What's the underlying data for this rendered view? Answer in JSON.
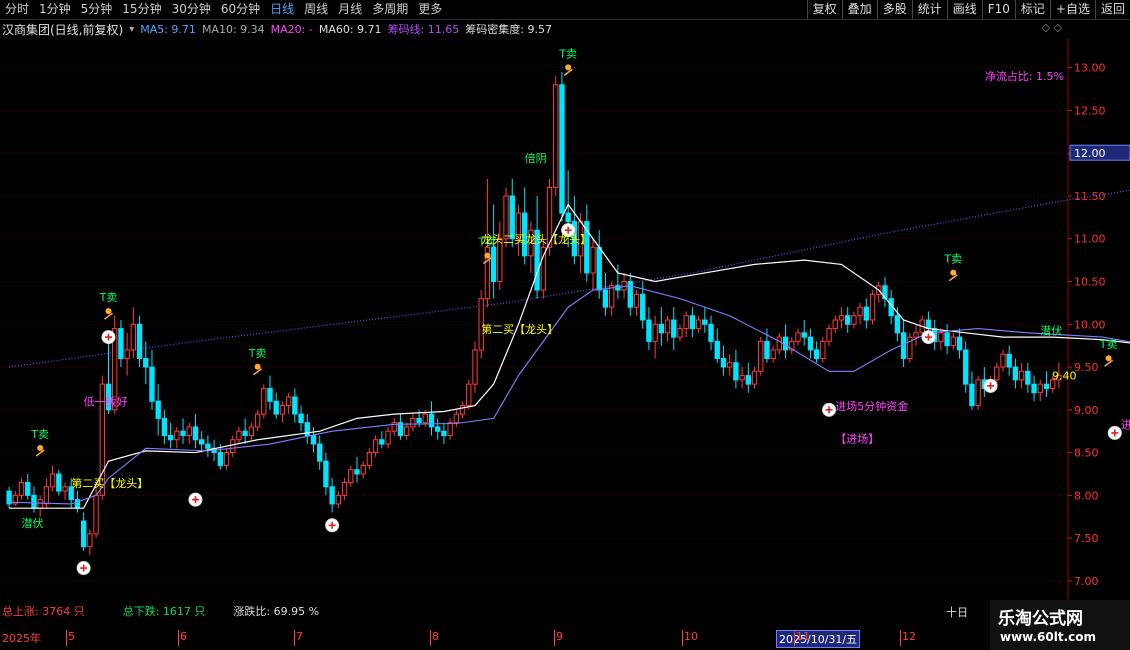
{
  "toolbar": {
    "periods": [
      "分时",
      "1分钟",
      "5分钟",
      "15分钟",
      "30分钟",
      "60分钟",
      "日线",
      "周线",
      "月线",
      "多周期",
      "更多"
    ],
    "active_period": 6,
    "tools": [
      "复权",
      "叠加",
      "多股",
      "统计",
      "画线",
      "F10",
      "标记",
      "+自选",
      "返回"
    ]
  },
  "info": {
    "stock_name": "汉商集团(日线,前复权)",
    "ma5": "MA5: 9.71",
    "ma10": "MA10: 9.34",
    "ma20": "MA20: -",
    "ma60": "MA60: 9.71",
    "chip_line": "筹码线: 11.65",
    "chip_density": "筹码密集度: 9.57",
    "icons": "◇ ◇"
  },
  "colors": {
    "up": "#ff3b3b",
    "down": "#00e5ff",
    "ma_line": "#ffffff",
    "ma2": "#8080ff",
    "buy": "#ffff00",
    "t_sell": "#00ff66",
    "magenta": "#ff40ff",
    "grid": "#8b0000"
  },
  "labels": {
    "net_flow": "净流占比: 1.5%",
    "total_up": "总上涨: 3764 只",
    "total_down": "总下跌: 1617 只",
    "updown_ratio": "涨跌比: 69.95 %",
    "right_bottom": "十日"
  },
  "dates": {
    "year": "2025年",
    "months": [
      "5",
      "6",
      "7",
      "8",
      "9",
      "10",
      "11",
      "12"
    ],
    "current": "2025/10/31/五"
  },
  "watermark": {
    "title": "乐淘公式网",
    "url": "www.60lt.com"
  },
  "chart_data": {
    "type": "candlestick",
    "ylim": [
      6.8,
      13.3
    ],
    "yticks": [
      7.0,
      7.5,
      8.0,
      8.5,
      9.0,
      9.5,
      10.0,
      10.5,
      11.0,
      11.5,
      12.0,
      12.5,
      13.0
    ],
    "yticks_labels": [
      "7.00",
      "7.50",
      "8.00",
      "8.50",
      "9.00",
      "9.50",
      "10.00",
      "10.50",
      "11.00",
      "11.50",
      "12.00",
      "12.50",
      "13.00"
    ],
    "highlight_price": "12.00",
    "last_price": "9.40",
    "ohlc": [
      [
        8.05,
        8.1,
        7.9,
        7.85
      ],
      [
        7.9,
        8.05,
        8.0,
        7.88
      ],
      [
        8.0,
        8.2,
        8.15,
        7.95
      ],
      [
        8.15,
        8.25,
        8.0,
        7.95
      ],
      [
        8.0,
        8.1,
        7.85,
        7.8
      ],
      [
        7.85,
        8.0,
        7.95,
        7.75
      ],
      [
        7.9,
        8.2,
        8.1,
        7.85
      ],
      [
        8.1,
        8.35,
        8.25,
        8.05
      ],
      [
        8.25,
        8.3,
        8.05,
        8.0
      ],
      [
        8.05,
        8.15,
        8.1,
        7.95
      ],
      [
        8.1,
        8.2,
        7.95,
        7.85
      ],
      [
        7.95,
        8.05,
        7.85,
        7.8
      ],
      [
        7.7,
        7.8,
        7.4,
        7.35
      ],
      [
        7.4,
        7.6,
        7.55,
        7.3
      ],
      [
        7.55,
        8.1,
        8.0,
        7.5
      ],
      [
        8.0,
        9.4,
        9.3,
        7.95
      ],
      [
        9.3,
        9.8,
        9.0,
        8.95
      ],
      [
        9.0,
        10.1,
        9.95,
        8.95
      ],
      [
        9.95,
        10.05,
        9.6,
        9.5
      ],
      [
        9.6,
        9.9,
        9.7,
        9.4
      ],
      [
        9.7,
        10.2,
        10.0,
        9.6
      ],
      [
        10.0,
        10.1,
        9.6,
        9.5
      ],
      [
        9.6,
        9.8,
        9.5,
        9.3
      ],
      [
        9.5,
        9.7,
        9.1,
        9.0
      ],
      [
        9.1,
        9.3,
        8.9,
        8.7
      ],
      [
        8.9,
        9.0,
        8.7,
        8.6
      ],
      [
        8.7,
        8.85,
        8.65,
        8.55
      ],
      [
        8.65,
        8.8,
        8.75,
        8.55
      ],
      [
        8.75,
        8.9,
        8.7,
        8.6
      ],
      [
        8.7,
        8.85,
        8.8,
        8.6
      ],
      [
        8.8,
        8.95,
        8.65,
        8.55
      ],
      [
        8.65,
        8.75,
        8.6,
        8.5
      ],
      [
        8.6,
        8.7,
        8.55,
        8.45
      ],
      [
        8.55,
        8.65,
        8.5,
        8.4
      ],
      [
        8.5,
        8.6,
        8.35,
        8.3
      ],
      [
        8.35,
        8.55,
        8.5,
        8.3
      ],
      [
        8.5,
        8.7,
        8.65,
        8.45
      ],
      [
        8.65,
        8.8,
        8.75,
        8.6
      ],
      [
        8.75,
        8.9,
        8.7,
        8.6
      ],
      [
        8.7,
        8.85,
        8.8,
        8.65
      ],
      [
        8.8,
        9.0,
        8.95,
        8.75
      ],
      [
        8.95,
        9.3,
        9.25,
        8.9
      ],
      [
        9.25,
        9.4,
        9.1,
        9.0
      ],
      [
        9.1,
        9.2,
        8.95,
        8.9
      ],
      [
        8.95,
        9.1,
        9.05,
        8.85
      ],
      [
        9.05,
        9.2,
        9.15,
        8.95
      ],
      [
        9.15,
        9.25,
        8.95,
        8.85
      ],
      [
        8.95,
        9.05,
        8.85,
        8.75
      ],
      [
        8.85,
        8.95,
        8.7,
        8.6
      ],
      [
        8.7,
        8.8,
        8.6,
        8.5
      ],
      [
        8.6,
        8.7,
        8.4,
        8.3
      ],
      [
        8.4,
        8.5,
        8.1,
        8.0
      ],
      [
        8.1,
        8.2,
        7.9,
        7.8
      ],
      [
        7.9,
        8.05,
        8.0,
        7.85
      ],
      [
        8.0,
        8.2,
        8.15,
        7.95
      ],
      [
        8.15,
        8.35,
        8.3,
        8.1
      ],
      [
        8.3,
        8.45,
        8.25,
        8.15
      ],
      [
        8.25,
        8.4,
        8.35,
        8.2
      ],
      [
        8.35,
        8.55,
        8.5,
        8.3
      ],
      [
        8.5,
        8.7,
        8.65,
        8.45
      ],
      [
        8.65,
        8.75,
        8.6,
        8.55
      ],
      [
        8.6,
        8.8,
        8.75,
        8.55
      ],
      [
        8.75,
        8.9,
        8.85,
        8.7
      ],
      [
        8.85,
        8.95,
        8.7,
        8.65
      ],
      [
        8.7,
        8.85,
        8.8,
        8.65
      ],
      [
        8.8,
        8.95,
        8.9,
        8.75
      ],
      [
        8.9,
        9.0,
        8.85,
        8.8
      ],
      [
        8.85,
        9.0,
        8.95,
        8.8
      ],
      [
        8.95,
        9.1,
        8.8,
        8.7
      ],
      [
        8.8,
        8.9,
        8.75,
        8.65
      ],
      [
        8.75,
        8.85,
        8.7,
        8.6
      ],
      [
        8.7,
        8.9,
        8.85,
        8.65
      ],
      [
        8.85,
        9.0,
        8.95,
        8.8
      ],
      [
        8.95,
        9.1,
        9.05,
        8.9
      ],
      [
        9.05,
        9.35,
        9.3,
        9.0
      ],
      [
        9.3,
        9.8,
        9.7,
        9.2
      ],
      [
        9.7,
        10.4,
        10.3,
        9.6
      ],
      [
        10.3,
        11.7,
        10.9,
        10.2
      ],
      [
        10.9,
        11.4,
        10.5,
        10.3
      ],
      [
        10.5,
        11.2,
        11.0,
        10.4
      ],
      [
        11.0,
        11.6,
        11.5,
        10.9
      ],
      [
        11.5,
        11.7,
        11.0,
        10.9
      ],
      [
        11.0,
        11.4,
        11.3,
        10.8
      ],
      [
        11.3,
        11.6,
        10.8,
        10.7
      ],
      [
        10.8,
        11.2,
        11.1,
        10.6
      ],
      [
        11.1,
        11.5,
        10.4,
        10.3
      ],
      [
        10.4,
        11.0,
        10.9,
        10.3
      ],
      [
        10.9,
        11.7,
        11.6,
        10.8
      ],
      [
        11.6,
        12.9,
        12.8,
        11.5
      ],
      [
        12.8,
        12.95,
        11.3,
        11.2
      ],
      [
        11.3,
        11.8,
        11.2,
        10.9
      ],
      [
        11.2,
        11.5,
        10.8,
        10.7
      ],
      [
        10.8,
        11.3,
        11.2,
        10.6
      ],
      [
        11.2,
        11.4,
        10.6,
        10.5
      ],
      [
        10.6,
        11.0,
        10.9,
        10.4
      ],
      [
        10.9,
        11.1,
        10.4,
        10.3
      ],
      [
        10.4,
        10.6,
        10.2,
        10.1
      ],
      [
        10.2,
        10.5,
        10.45,
        10.1
      ],
      [
        10.45,
        10.7,
        10.4,
        10.3
      ],
      [
        10.4,
        10.6,
        10.5,
        10.3
      ],
      [
        10.5,
        10.6,
        10.2,
        10.1
      ],
      [
        10.2,
        10.4,
        10.35,
        10.1
      ],
      [
        10.35,
        10.5,
        10.05,
        9.95
      ],
      [
        10.05,
        10.2,
        9.8,
        9.7
      ],
      [
        9.8,
        10.1,
        10.0,
        9.6
      ],
      [
        10.0,
        10.2,
        9.9,
        9.75
      ],
      [
        9.9,
        10.1,
        10.05,
        9.8
      ],
      [
        10.05,
        10.2,
        9.85,
        9.7
      ],
      [
        9.85,
        10.0,
        9.95,
        9.8
      ],
      [
        9.95,
        10.15,
        10.1,
        9.85
      ],
      [
        10.1,
        10.2,
        9.95,
        9.85
      ],
      [
        9.95,
        10.1,
        10.05,
        9.9
      ],
      [
        10.05,
        10.2,
        10.0,
        9.9
      ],
      [
        10.0,
        10.1,
        9.8,
        9.7
      ],
      [
        9.8,
        9.95,
        9.6,
        9.55
      ],
      [
        9.6,
        9.75,
        9.5,
        9.4
      ],
      [
        9.5,
        9.65,
        9.55,
        9.4
      ],
      [
        9.55,
        9.7,
        9.35,
        9.25
      ],
      [
        9.35,
        9.5,
        9.4,
        9.25
      ],
      [
        9.4,
        9.55,
        9.3,
        9.2
      ],
      [
        9.3,
        9.5,
        9.45,
        9.25
      ],
      [
        9.45,
        9.85,
        9.8,
        9.4
      ],
      [
        9.8,
        9.95,
        9.6,
        9.55
      ],
      [
        9.6,
        9.75,
        9.7,
        9.55
      ],
      [
        9.7,
        9.9,
        9.85,
        9.65
      ],
      [
        9.85,
        10.0,
        9.7,
        9.6
      ],
      [
        9.7,
        9.85,
        9.8,
        9.65
      ],
      [
        9.8,
        9.95,
        9.9,
        9.75
      ],
      [
        9.9,
        10.05,
        9.85,
        9.75
      ],
      [
        9.85,
        9.95,
        9.7,
        9.6
      ],
      [
        9.7,
        9.8,
        9.6,
        9.55
      ],
      [
        9.6,
        9.85,
        9.8,
        9.55
      ],
      [
        9.8,
        10.0,
        9.95,
        9.75
      ],
      [
        9.95,
        10.1,
        10.05,
        9.9
      ],
      [
        10.05,
        10.2,
        10.1,
        9.95
      ],
      [
        10.1,
        10.2,
        10.0,
        9.9
      ],
      [
        10.0,
        10.15,
        10.1,
        9.95
      ],
      [
        10.1,
        10.25,
        10.2,
        10.0
      ],
      [
        10.2,
        10.3,
        10.05,
        9.95
      ],
      [
        10.05,
        10.4,
        10.35,
        10.0
      ],
      [
        10.35,
        10.5,
        10.45,
        10.25
      ],
      [
        10.45,
        10.55,
        10.3,
        10.2
      ],
      [
        10.3,
        10.4,
        10.1,
        10.0
      ],
      [
        10.1,
        10.2,
        9.9,
        9.8
      ],
      [
        9.9,
        10.05,
        9.6,
        9.5
      ],
      [
        9.6,
        9.9,
        9.85,
        9.55
      ],
      [
        9.85,
        10.0,
        9.9,
        9.75
      ],
      [
        9.9,
        10.1,
        10.05,
        9.85
      ],
      [
        10.05,
        10.15,
        9.95,
        9.85
      ],
      [
        9.95,
        10.05,
        9.8,
        9.7
      ],
      [
        9.8,
        9.95,
        9.9,
        9.7
      ],
      [
        9.9,
        10.0,
        9.75,
        9.65
      ],
      [
        9.75,
        9.9,
        9.85,
        9.7
      ],
      [
        9.85,
        9.95,
        9.7,
        9.6
      ],
      [
        9.7,
        9.8,
        9.3,
        9.2
      ],
      [
        9.3,
        9.45,
        9.05,
        9.0
      ],
      [
        9.05,
        9.4,
        9.35,
        9.0
      ],
      [
        9.35,
        9.5,
        9.25,
        9.15
      ],
      [
        9.25,
        9.4,
        9.35,
        9.2
      ],
      [
        9.35,
        9.55,
        9.5,
        9.3
      ],
      [
        9.5,
        9.7,
        9.65,
        9.45
      ],
      [
        9.65,
        9.75,
        9.5,
        9.4
      ],
      [
        9.5,
        9.6,
        9.35,
        9.25
      ],
      [
        9.35,
        9.55,
        9.45,
        9.25
      ],
      [
        9.45,
        9.55,
        9.3,
        9.2
      ],
      [
        9.3,
        9.4,
        9.2,
        9.1
      ],
      [
        9.2,
        9.35,
        9.3,
        9.1
      ],
      [
        9.3,
        9.45,
        9.25,
        9.15
      ],
      [
        9.25,
        9.4,
        9.35,
        9.2
      ],
      [
        9.35,
        9.55,
        9.4,
        9.25
      ]
    ],
    "ma_white": [
      [
        0,
        7.85
      ],
      [
        8,
        7.85
      ],
      [
        12,
        7.85
      ],
      [
        16,
        8.4
      ],
      [
        22,
        8.52
      ],
      [
        30,
        8.5
      ],
      [
        40,
        8.65
      ],
      [
        50,
        8.75
      ],
      [
        56,
        8.9
      ],
      [
        62,
        8.95
      ],
      [
        70,
        8.98
      ],
      [
        75,
        9.05
      ],
      [
        78,
        9.3
      ],
      [
        82,
        10.0
      ],
      [
        86,
        10.8
      ],
      [
        90,
        11.4
      ],
      [
        94,
        11.0
      ],
      [
        98,
        10.6
      ],
      [
        104,
        10.5
      ],
      [
        112,
        10.6
      ],
      [
        120,
        10.7
      ],
      [
        128,
        10.75
      ],
      [
        134,
        10.7
      ],
      [
        140,
        10.4
      ],
      [
        144,
        10.05
      ],
      [
        148,
        9.95
      ],
      [
        154,
        9.9
      ],
      [
        160,
        9.85
      ],
      [
        168,
        9.85
      ],
      [
        176,
        9.82
      ],
      [
        188,
        9.72
      ]
    ],
    "ma_blue": [
      [
        0,
        7.92
      ],
      [
        10,
        7.9
      ],
      [
        14,
        8.0
      ],
      [
        16,
        8.2
      ],
      [
        22,
        8.55
      ],
      [
        32,
        8.52
      ],
      [
        42,
        8.6
      ],
      [
        52,
        8.75
      ],
      [
        62,
        8.83
      ],
      [
        72,
        8.84
      ],
      [
        78,
        8.9
      ],
      [
        82,
        9.4
      ],
      [
        86,
        9.8
      ],
      [
        90,
        10.2
      ],
      [
        94,
        10.4
      ],
      [
        100,
        10.45
      ],
      [
        108,
        10.3
      ],
      [
        116,
        10.1
      ],
      [
        124,
        9.8
      ],
      [
        132,
        9.45
      ],
      [
        136,
        9.45
      ],
      [
        142,
        9.7
      ],
      [
        148,
        9.9
      ],
      [
        156,
        9.95
      ],
      [
        164,
        9.9
      ],
      [
        176,
        9.85
      ],
      [
        188,
        9.7
      ]
    ],
    "chip_line_pts": [
      [
        0,
        9.5
      ],
      [
        30,
        9.8
      ],
      [
        80,
        10.25
      ],
      [
        110,
        10.6
      ],
      [
        140,
        11.05
      ],
      [
        170,
        11.45
      ],
      [
        188,
        11.65
      ]
    ],
    "signals": [
      {
        "type": "T卖",
        "idx": 5,
        "price": 8.6
      },
      {
        "type": "T卖",
        "idx": 16,
        "price": 10.2
      },
      {
        "type": "T卖",
        "idx": 40,
        "price": 9.55
      },
      {
        "type": "T卖",
        "idx": 77,
        "price": 10.85
      },
      {
        "type": "T卖",
        "idx": 90,
        "price": 13.05
      },
      {
        "type": "T卖",
        "idx": 152,
        "price": 10.65
      },
      {
        "type": "T卖",
        "idx": 177,
        "price": 9.65
      }
    ],
    "circles": [
      [
        12,
        7.15
      ],
      [
        16,
        9.85
      ],
      [
        30,
        7.95
      ],
      [
        52,
        7.65
      ],
      [
        90,
        11.1
      ],
      [
        132,
        9.0
      ],
      [
        148,
        9.85
      ],
      [
        158,
        9.28
      ],
      [
        178,
        8.73
      ]
    ],
    "texts": [
      {
        "t": "潜伏",
        "idx": 2,
        "price": 7.63,
        "c": "#00ff66"
      },
      {
        "t": "倍阴",
        "idx": 83,
        "price": 11.9,
        "c": "#00ff66"
      },
      {
        "t": "潜伏",
        "idx": 166,
        "price": 9.88,
        "c": "#00ff66"
      },
      {
        "t": "第二买【龙头】",
        "idx": 10,
        "price": 8.1,
        "c": "#ffff00"
      },
      {
        "t": "第二买【龙头】",
        "idx": 76,
        "price": 9.9,
        "c": "#ffff00"
      },
      {
        "t": "龙头二买龙头【龙头】",
        "idx": 76,
        "price": 10.95,
        "c": "#ffff00"
      },
      {
        "t": "低一叛好",
        "idx": 12,
        "price": 9.05,
        "c": "#ff40ff"
      },
      {
        "t": "进场5分钟资金",
        "idx": 133,
        "price": 9.0,
        "c": "#ff40ff"
      },
      {
        "t": "【进场】",
        "idx": 133,
        "price": 8.62,
        "c": "#ff40ff"
      },
      {
        "t": "进场5分钟资金",
        "idx": 179,
        "price": 8.78,
        "c": "#ff40ff"
      },
      {
        "t": "【进场】",
        "idx": 181,
        "price": 8.44,
        "c": "#ff40ff"
      }
    ]
  }
}
